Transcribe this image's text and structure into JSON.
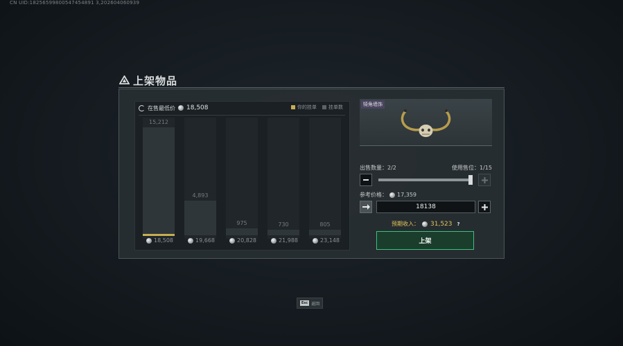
{
  "uid": "CN UID:18256599800547454891 3,202604060939",
  "header": {
    "title": "上架物品",
    "icon": "triangle-logo-icon"
  },
  "market": {
    "lowest_price_label": "在售最低价",
    "lowest_price": "18,508",
    "legend_yours": "你的挂单",
    "legend_listings": "挂单数",
    "colors": {
      "yours": "#c8ad52",
      "listings": "#5c6366"
    }
  },
  "chart_data": {
    "type": "bar",
    "categories": [
      "18,508",
      "19,668",
      "20,828",
      "21,988",
      "23,148"
    ],
    "values": [
      15212,
      4893,
      975,
      730,
      805
    ],
    "count_labels": [
      "15,212",
      "4,893",
      "975",
      "730",
      "805"
    ],
    "your_listing_category": "18,508"
  },
  "item": {
    "name": "犄角墙饰"
  },
  "sell": {
    "quantity_label": "出售数量：",
    "quantity_value": "2/2",
    "slot_label": "使用售位：",
    "slot_value": "1/15"
  },
  "reference": {
    "label": "参考价格：",
    "value": "17,359"
  },
  "price_input": {
    "value": "18138"
  },
  "income": {
    "label": "预期收入：",
    "value": "31,523",
    "help": "?",
    "color": "#e2c45c"
  },
  "list_button": {
    "label": "上架",
    "accent": "#3fc07e"
  },
  "footer": {
    "key": "Esc",
    "label": "返回"
  }
}
